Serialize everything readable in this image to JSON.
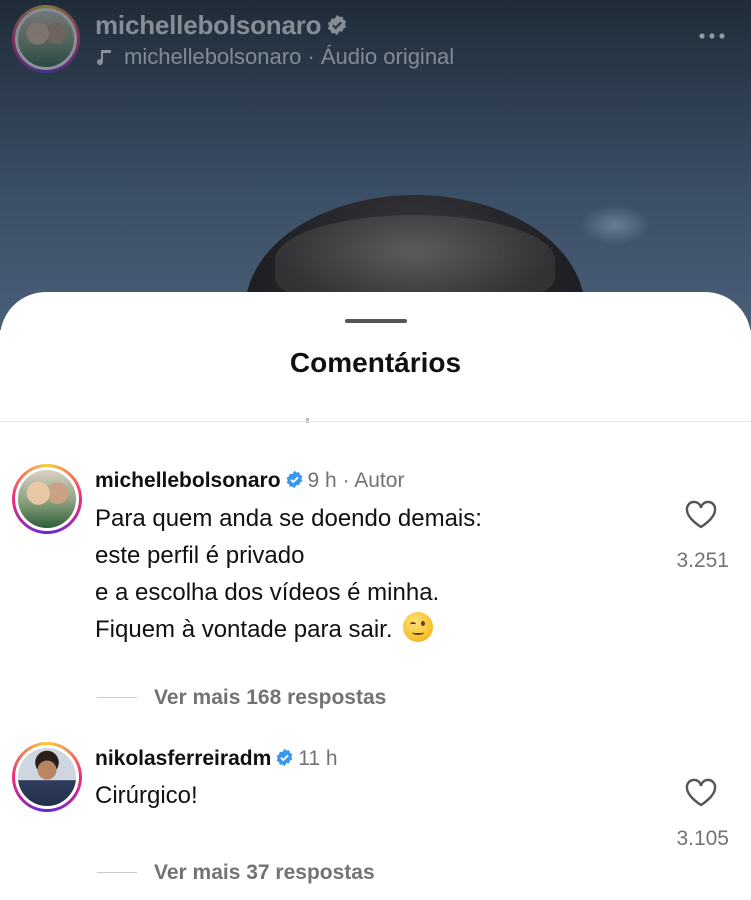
{
  "post_header": {
    "username": "michellebolsonaro",
    "audio_label": "michellebolsonaro · Áudio original"
  },
  "sheet": {
    "title": "Comentários"
  },
  "comments": [
    {
      "username": "michellebolsonaro",
      "meta": "9 h · Autor",
      "text_lines": [
        "Para quem anda se doendo demais:",
        "este perfil é privado",
        "e a escolha dos vídeos é minha.",
        "Fiquem à vontade para sair."
      ],
      "emoji": "winking-face",
      "likes": "3.251",
      "view_replies": "Ver mais 168 respostas"
    },
    {
      "username": "nikolasferreiradm",
      "meta": "11 h",
      "text_lines": [
        "Cirúrgico!"
      ],
      "likes": "3.105",
      "view_replies": "Ver mais 37 respostas"
    }
  ],
  "colors": {
    "verified_blue": "#3897f0",
    "secondary_text": "#737373"
  },
  "icons": [
    "verified-icon",
    "music-note-icon",
    "more-options-icon",
    "heart-icon",
    "winking-emoji-icon"
  ]
}
